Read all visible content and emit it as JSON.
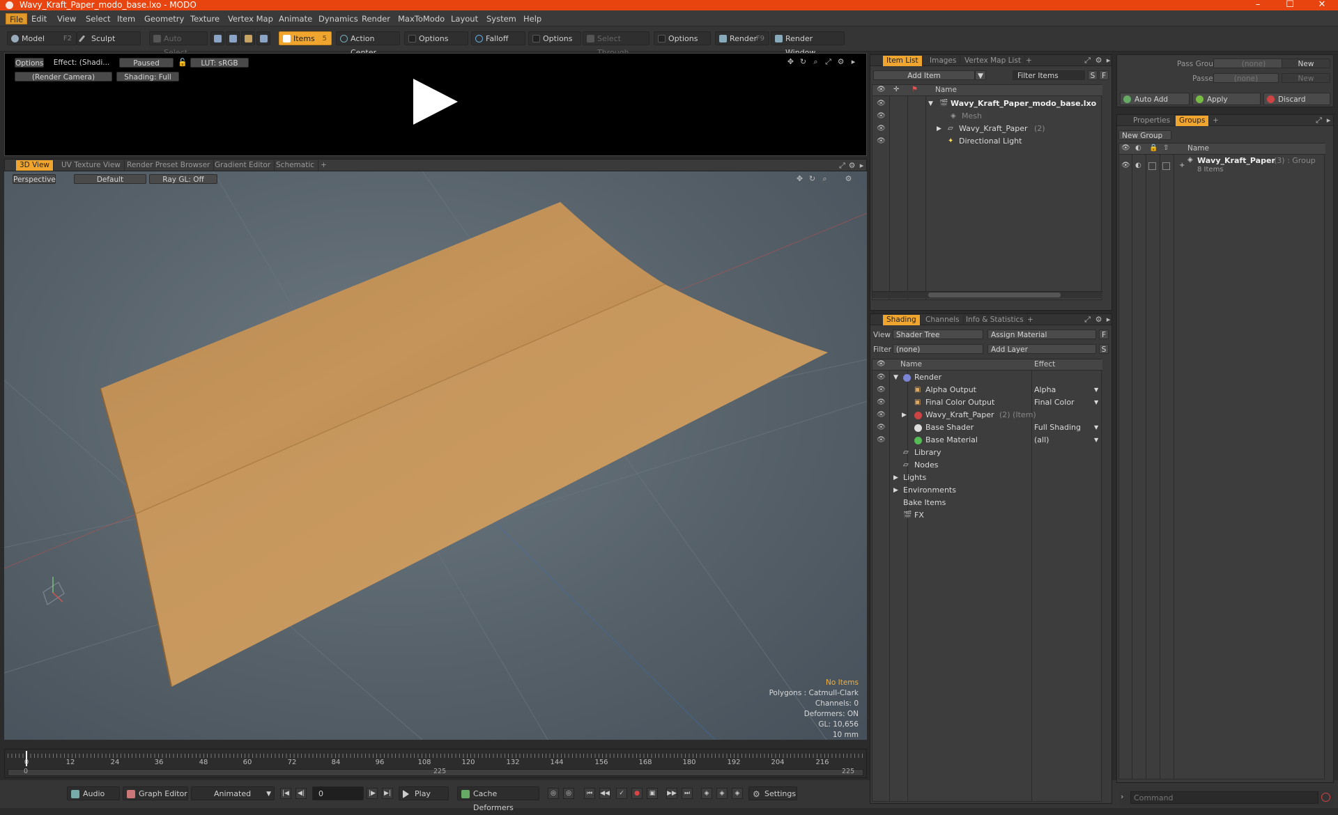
{
  "window": {
    "title": "Wavy_Kraft_Paper_modo_base.lxo - MODO",
    "min": "–",
    "max": "☐",
    "close": "✕"
  },
  "menu": [
    "File",
    "Edit",
    "View",
    "Select",
    "Item",
    "Geometry",
    "Texture",
    "Vertex Map",
    "Animate",
    "Dynamics",
    "Render",
    "MaxToModo",
    "Layout",
    "System",
    "Help"
  ],
  "toolbar": {
    "model": "Model",
    "model_key": "F2",
    "sculpt": "Sculpt",
    "auto_select": "Auto Select",
    "items": "Items",
    "items_key": "5",
    "action_center": "Action Center",
    "options1": "Options",
    "falloff": "Falloff",
    "options2": "Options",
    "select_through": "Select Through",
    "options3": "Options",
    "render": "Render",
    "render_key": "F9",
    "render_window": "Render Window"
  },
  "render_view": {
    "options": "Options",
    "effect": "Effect: (Shadi...",
    "paused": "Paused",
    "lut": "LUT: sRGB",
    "camera": "(Render Camera)",
    "shading": "Shading: Full"
  },
  "view_tabs": [
    "3D View",
    "UV Texture View",
    "Render Preset Browser",
    "Gradient Editor",
    "Schematic",
    "+"
  ],
  "viewport": {
    "perspective": "Perspective",
    "default": "Default",
    "raygl": "Ray GL: Off",
    "info": {
      "no_items": "No Items",
      "polygons": "Polygons : Catmull-Clark",
      "channels": "Channels: 0",
      "deformers": "Deformers: ON",
      "gl": "GL: 10,656",
      "scale": "10 mm"
    }
  },
  "timeline": {
    "ticks": [
      "0",
      "12",
      "24",
      "36",
      "48",
      "60",
      "72",
      "84",
      "96",
      "108",
      "120",
      "132",
      "144",
      "156",
      "168",
      "180",
      "192",
      "204",
      "216"
    ],
    "start": "0",
    "mid": "225",
    "end": "225"
  },
  "statusbar": {
    "audio": "Audio",
    "graph_editor": "Graph Editor",
    "animated": "Animated",
    "frame": "0",
    "play": "Play",
    "cache": "Cache Deformers",
    "settings": "Settings"
  },
  "item_list": {
    "tabs": [
      "Item List",
      "Images",
      "Vertex Map List",
      "+"
    ],
    "add_item": "Add Item",
    "filter": "Filter Items",
    "s": "S",
    "f": "F",
    "col_name": "Name",
    "rows": [
      {
        "label": "Wavy_Kraft_Paper_modo_base.lxo",
        "extra": ""
      },
      {
        "label": "Mesh",
        "extra": ""
      },
      {
        "label": "Wavy_Kraft_Paper",
        "extra": "(2)"
      },
      {
        "label": "Directional Light",
        "extra": ""
      }
    ]
  },
  "shading": {
    "tabs": [
      "Shading",
      "Channels",
      "Info & Statistics",
      "+"
    ],
    "view_lbl": "View",
    "view_val": "Shader Tree",
    "assign": "Assign Material",
    "f": "F",
    "filter_lbl": "Filter",
    "filter_val": "(none)",
    "add_layer": "Add Layer",
    "s": "S",
    "col_name": "Name",
    "col_effect": "Effect",
    "rows": [
      {
        "label": "Render",
        "extra": "",
        "effect": ""
      },
      {
        "label": "Alpha Output",
        "extra": "",
        "effect": "Alpha"
      },
      {
        "label": "Final Color Output",
        "extra": "",
        "effect": "Final Color"
      },
      {
        "label": "Wavy_Kraft_Paper",
        "extra": "(2) (Item)",
        "effect": ""
      },
      {
        "label": "Base Shader",
        "extra": "",
        "effect": "Full Shading"
      },
      {
        "label": "Base Material",
        "extra": "",
        "effect": "(all)"
      },
      {
        "label": "Library",
        "extra": "",
        "effect": ""
      },
      {
        "label": "Nodes",
        "extra": "",
        "effect": ""
      },
      {
        "label": "Lights",
        "extra": "",
        "effect": ""
      },
      {
        "label": "Environments",
        "extra": "",
        "effect": ""
      },
      {
        "label": "Bake Items",
        "extra": "",
        "effect": ""
      },
      {
        "label": "FX",
        "extra": "",
        "effect": ""
      }
    ]
  },
  "groups": {
    "pass_groups": "Pass Groups",
    "pass_val": "(none)",
    "new1": "New",
    "passes": "Passes",
    "passes_val": "(none)",
    "new2": "New",
    "auto_add": "Auto Add",
    "apply": "Apply",
    "discard": "Discard",
    "tabs": [
      "Properties",
      "Groups",
      "+"
    ],
    "new_group": "New Group",
    "col_name": "Name",
    "item_name": "Wavy_Kraft_Paper",
    "item_extra": "(3) : Group",
    "item_count": "8 Items"
  },
  "command": {
    "placeholder": "Command"
  }
}
